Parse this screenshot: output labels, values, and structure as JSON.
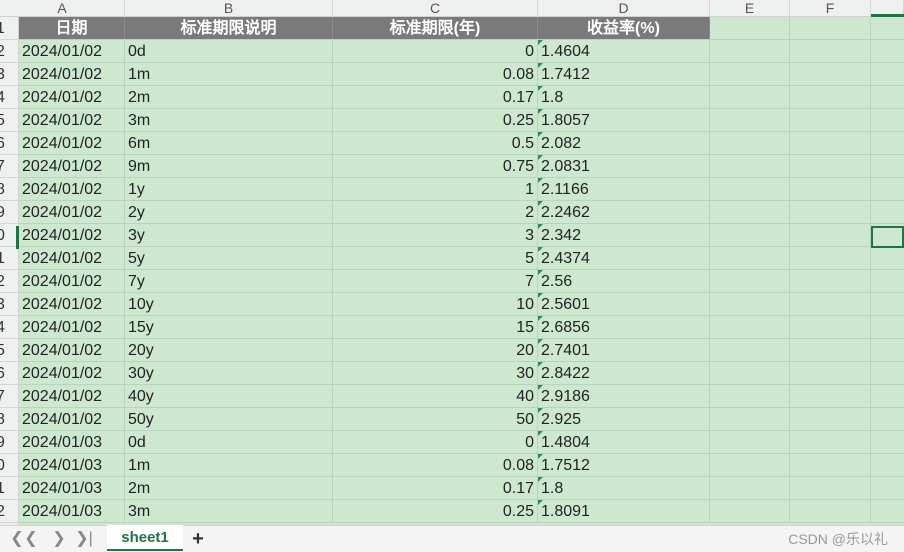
{
  "colors": {
    "accent": "#217346",
    "header_bg": "#7a7a7a",
    "sheet_bg": "#cde8cf"
  },
  "column_headers": [
    "A",
    "B",
    "C",
    "D",
    "E",
    "F"
  ],
  "header_cells": [
    "日期",
    "标准期限说明",
    "标准期限(年)",
    "收益率(%)"
  ],
  "rows": [
    {
      "num": "2",
      "date": "2024/01/02",
      "term": "0d",
      "years": "0",
      "rate": "1.4604"
    },
    {
      "num": "3",
      "date": "2024/01/02",
      "term": "1m",
      "years": "0.08",
      "rate": "1.7412"
    },
    {
      "num": "4",
      "date": "2024/01/02",
      "term": "2m",
      "years": "0.17",
      "rate": "1.8"
    },
    {
      "num": "5",
      "date": "2024/01/02",
      "term": "3m",
      "years": "0.25",
      "rate": "1.8057"
    },
    {
      "num": "6",
      "date": "2024/01/02",
      "term": "6m",
      "years": "0.5",
      "rate": "2.082"
    },
    {
      "num": "7",
      "date": "2024/01/02",
      "term": "9m",
      "years": "0.75",
      "rate": "2.0831"
    },
    {
      "num": "8",
      "date": "2024/01/02",
      "term": "1y",
      "years": "1",
      "rate": "2.1166"
    },
    {
      "num": "9",
      "date": "2024/01/02",
      "term": "2y",
      "years": "2",
      "rate": "2.2462"
    },
    {
      "num": "0",
      "date": "2024/01/02",
      "term": "3y",
      "years": "3",
      "rate": "2.342"
    },
    {
      "num": "1",
      "date": "2024/01/02",
      "term": "5y",
      "years": "5",
      "rate": "2.4374"
    },
    {
      "num": "2",
      "date": "2024/01/02",
      "term": "7y",
      "years": "7",
      "rate": "2.56"
    },
    {
      "num": "3",
      "date": "2024/01/02",
      "term": "10y",
      "years": "10",
      "rate": "2.5601"
    },
    {
      "num": "4",
      "date": "2024/01/02",
      "term": "15y",
      "years": "15",
      "rate": "2.6856"
    },
    {
      "num": "5",
      "date": "2024/01/02",
      "term": "20y",
      "years": "20",
      "rate": "2.7401"
    },
    {
      "num": "6",
      "date": "2024/01/02",
      "term": "30y",
      "years": "30",
      "rate": "2.8422"
    },
    {
      "num": "7",
      "date": "2024/01/02",
      "term": "40y",
      "years": "40",
      "rate": "2.9186"
    },
    {
      "num": "8",
      "date": "2024/01/02",
      "term": "50y",
      "years": "50",
      "rate": "2.925"
    },
    {
      "num": "9",
      "date": "2024/01/03",
      "term": "0d",
      "years": "0",
      "rate": "1.4804"
    },
    {
      "num": "0",
      "date": "2024/01/03",
      "term": "1m",
      "years": "0.08",
      "rate": "1.7512"
    },
    {
      "num": "1",
      "date": "2024/01/03",
      "term": "2m",
      "years": "0.17",
      "rate": "1.8"
    },
    {
      "num": "2",
      "date": "2024/01/03",
      "term": "3m",
      "years": "0.25",
      "rate": "1.8091"
    }
  ],
  "header_row_num": "1",
  "tabbar": {
    "nav": [
      {
        "name": "first-sheet-button",
        "glyph": "|<"
      },
      {
        "name": "prev-sheet-button",
        "glyph": "<"
      },
      {
        "name": "next-sheet-button",
        "glyph": ">"
      },
      {
        "name": "last-sheet-button",
        "glyph": ">|"
      }
    ],
    "sheet_tab": "sheet1",
    "add": "+",
    "watermark": "CSDN @乐以礼"
  }
}
